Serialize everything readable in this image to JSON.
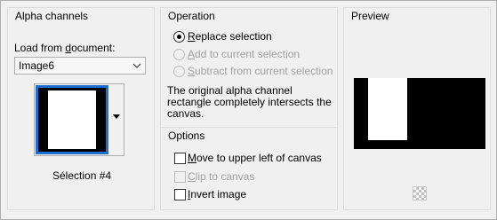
{
  "alpha_channels": {
    "title": "Alpha channels",
    "load_label_pre": "Load from ",
    "load_label_u": "d",
    "load_label_post": "ocument:",
    "document_value": "Image6",
    "selection_name": "Sélection #4"
  },
  "operation": {
    "title": "Operation",
    "options": [
      {
        "u": "R",
        "rest": "eplace selection",
        "selected": true,
        "enabled": true
      },
      {
        "u": "A",
        "rest": "dd to current selection",
        "selected": false,
        "enabled": false
      },
      {
        "u": "S",
        "rest": "ubtract from current selection",
        "selected": false,
        "enabled": false
      }
    ],
    "message_line1": "The original alpha channel",
    "message_line2": "rectangle completely intersects the",
    "message_line3": "canvas."
  },
  "options": {
    "title": "Options",
    "items": [
      {
        "u": "M",
        "rest": "ove to upper left of canvas",
        "checked": false,
        "enabled": true
      },
      {
        "u": "C",
        "rest": "lip to canvas",
        "checked": false,
        "enabled": false
      },
      {
        "u": "I",
        "rest": "nvert image",
        "checked": false,
        "enabled": true
      }
    ]
  },
  "preview": {
    "title": "Preview",
    "zoom_icon": "checkerboard-icon"
  }
}
